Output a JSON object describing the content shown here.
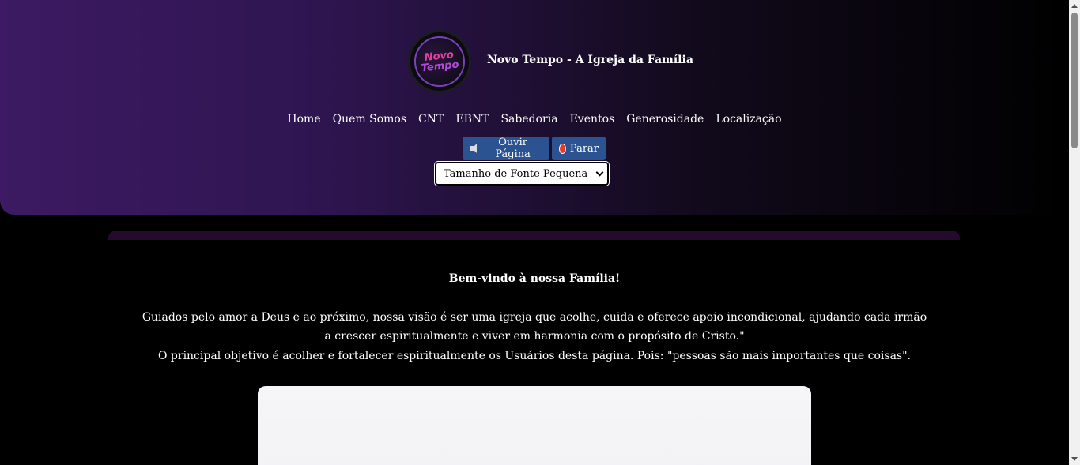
{
  "header": {
    "logo_text": [
      "Novo",
      "Tempo"
    ],
    "site_title": "Novo Tempo - A Igreja da Família",
    "nav": [
      "Home",
      "Quem Somos",
      "CNT",
      "EBNT",
      "Sabedoria",
      "Eventos",
      "Generosidade",
      "Localização"
    ],
    "listen_button": "Ouvir Página",
    "stop_button": "Parar",
    "font_size_select": "Tamanho de Fonte Pequena"
  },
  "main": {
    "welcome": "Bem-vindo à nossa Família!",
    "mission": "Guiados pelo amor a Deus e ao próximo, nossa visão é ser uma igreja que acolhe, cuida e oferece apoio incondicional, ajudando cada irmão a crescer espiritualmente e viver em harmonia com o propósito de Cristo.\"",
    "objective": "O principal objetivo é acolher e fortalecer espiritualmente os Usuários desta página. Pois: \"pessoas são mais importantes que coisas\"."
  },
  "colors": {
    "header_gradient_start": "#3d1a63",
    "button_blue": "#2c5391",
    "stop_red": "#e53b2c"
  },
  "icons": {
    "listen": "speaker-icon",
    "stop": "stop-icon",
    "select": "chevron-down-icon"
  }
}
